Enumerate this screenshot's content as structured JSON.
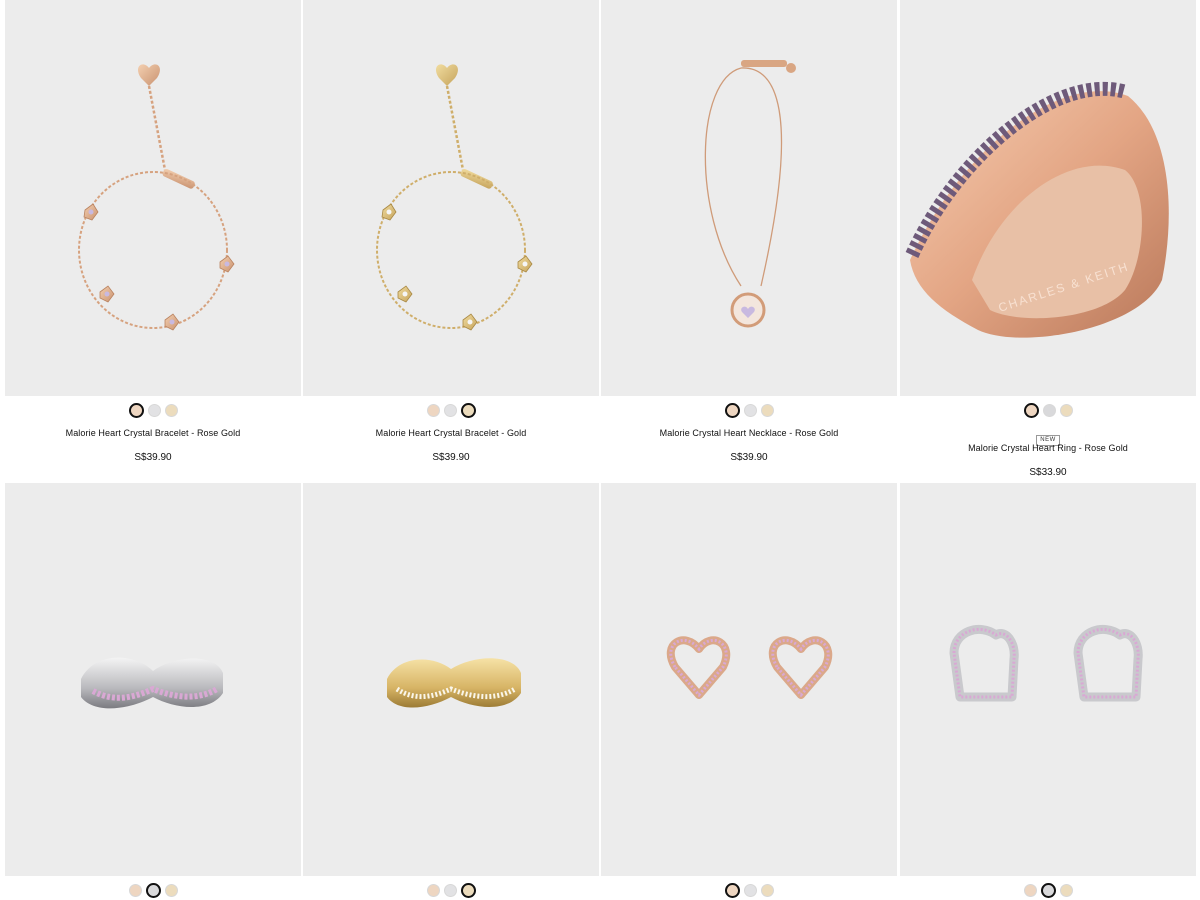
{
  "products": [
    {
      "name": "Malorie Heart Crystal Bracelet - Rose Gold",
      "price": "S$39.90",
      "badge": "",
      "swatches": [
        "#eed6c1",
        "#e2e2e4",
        "#ecdcbd"
      ],
      "selected": 0,
      "image": "bracelet-rose-gold"
    },
    {
      "name": "Malorie Heart Crystal Bracelet - Gold",
      "price": "S$39.90",
      "badge": "",
      "swatches": [
        "#eed6c1",
        "#e2e2e4",
        "#ecdcbd"
      ],
      "selected": 2,
      "image": "bracelet-gold"
    },
    {
      "name": "Malorie Crystal Heart Necklace - Rose Gold",
      "price": "S$39.90",
      "badge": "",
      "swatches": [
        "#eed6c1",
        "#e2e2e4",
        "#ecdcbd"
      ],
      "selected": 0,
      "image": "necklace-rose-gold"
    },
    {
      "name": "Malorie Crystal Heart Ring - Rose Gold",
      "price": "S$33.90",
      "badge": "NEW",
      "swatches": [
        "#eed6c1",
        "#d9d9db",
        "#ecdcbd"
      ],
      "selected": 0,
      "image": "ring-rose-gold"
    },
    {
      "name": "",
      "price": "",
      "badge": "",
      "swatches": [
        "#eed6c1",
        "#d9d9db",
        "#ecdcbd"
      ],
      "selected": 1,
      "image": "ring-silver"
    },
    {
      "name": "",
      "price": "",
      "badge": "",
      "swatches": [
        "#eed6c1",
        "#e2e2e4",
        "#ecdcbd"
      ],
      "selected": 2,
      "image": "ring-gold"
    },
    {
      "name": "",
      "price": "",
      "badge": "",
      "swatches": [
        "#eed6c1",
        "#e2e2e4",
        "#ecdcbd"
      ],
      "selected": 0,
      "image": "earrings-rose-gold"
    },
    {
      "name": "",
      "price": "",
      "badge": "",
      "swatches": [
        "#eed6c1",
        "#d9d9db",
        "#ecdcbd"
      ],
      "selected": 1,
      "image": "earrings-silver"
    }
  ],
  "ring_engraving": "CHARLES & KEITH"
}
